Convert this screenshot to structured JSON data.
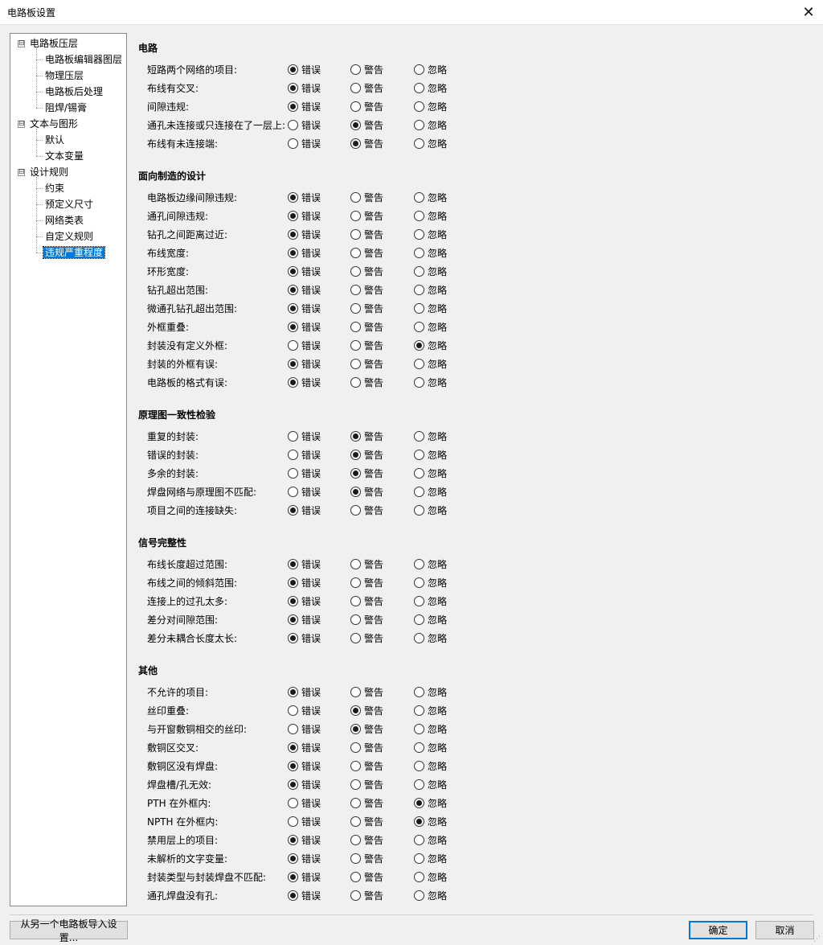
{
  "window": {
    "title": "电路板设置",
    "close_label": "✕"
  },
  "tree": [
    {
      "label": "电路板压层",
      "level": 0,
      "expander": "⊟"
    },
    {
      "label": "电路板编辑器图层",
      "level": 1
    },
    {
      "label": "物理压层",
      "level": 1
    },
    {
      "label": "电路板后处理",
      "level": 1
    },
    {
      "label": "阻焊/锡膏",
      "level": 1
    },
    {
      "label": "文本与图形",
      "level": 0,
      "expander": "⊟"
    },
    {
      "label": "默认",
      "level": 1
    },
    {
      "label": "文本变量",
      "level": 1
    },
    {
      "label": "设计规则",
      "level": 0,
      "expander": "⊟"
    },
    {
      "label": "约束",
      "level": 1
    },
    {
      "label": "预定义尺寸",
      "level": 1
    },
    {
      "label": "网络类表",
      "level": 1
    },
    {
      "label": "自定义规则",
      "level": 1
    },
    {
      "label": "违规严重程度",
      "level": 1,
      "selected": true
    }
  ],
  "options": {
    "error": "错误",
    "warning": "警告",
    "ignore": "忽略"
  },
  "sections": [
    {
      "title": "电路",
      "rows": [
        {
          "label": "短路两个网络的项目:",
          "value": "error"
        },
        {
          "label": "布线有交叉:",
          "value": "error"
        },
        {
          "label": "间隙违规:",
          "value": "error"
        },
        {
          "label": "通孔未连接或只连接在了一层上:",
          "value": "warning"
        },
        {
          "label": "布线有未连接端:",
          "value": "warning"
        }
      ]
    },
    {
      "title": "面向制造的设计",
      "rows": [
        {
          "label": "电路板边缘间隙违规:",
          "value": "error"
        },
        {
          "label": "通孔间隙违规:",
          "value": "error"
        },
        {
          "label": "钻孔之间距离过近:",
          "value": "error"
        },
        {
          "label": "布线宽度:",
          "value": "error"
        },
        {
          "label": "环形宽度:",
          "value": "error"
        },
        {
          "label": "钻孔超出范围:",
          "value": "error"
        },
        {
          "label": "微通孔钻孔超出范围:",
          "value": "error"
        },
        {
          "label": "外框重叠:",
          "value": "error"
        },
        {
          "label": "封装没有定义外框:",
          "value": "ignore"
        },
        {
          "label": "封装的外框有误:",
          "value": "error"
        },
        {
          "label": "电路板的格式有误:",
          "value": "error"
        }
      ]
    },
    {
      "title": "原理图一致性检验",
      "rows": [
        {
          "label": "重复的封装:",
          "value": "warning"
        },
        {
          "label": "错误的封装:",
          "value": "warning"
        },
        {
          "label": "多余的封装:",
          "value": "warning"
        },
        {
          "label": "焊盘网络与原理图不匹配:",
          "value": "warning"
        },
        {
          "label": "项目之间的连接缺失:",
          "value": "error"
        }
      ]
    },
    {
      "title": "信号完整性",
      "rows": [
        {
          "label": "布线长度超过范围:",
          "value": "error"
        },
        {
          "label": "布线之间的倾斜范围:",
          "value": "error"
        },
        {
          "label": "连接上的过孔太多:",
          "value": "error"
        },
        {
          "label": "差分对间隙范围:",
          "value": "error"
        },
        {
          "label": "差分未耦合长度太长:",
          "value": "error"
        }
      ]
    },
    {
      "title": "其他",
      "rows": [
        {
          "label": "不允许的项目:",
          "value": "error"
        },
        {
          "label": "丝印重叠:",
          "value": "warning"
        },
        {
          "label": "与开窗敷铜相交的丝印:",
          "value": "warning"
        },
        {
          "label": "敷铜区交叉:",
          "value": "error"
        },
        {
          "label": "敷铜区没有焊盘:",
          "value": "error"
        },
        {
          "label": "焊盘槽/孔无效:",
          "value": "error"
        },
        {
          "label": "PTH 在外框内:",
          "value": "ignore"
        },
        {
          "label": "NPTH 在外框内:",
          "value": "ignore"
        },
        {
          "label": "禁用层上的项目:",
          "value": "error"
        },
        {
          "label": "未解析的文字变量:",
          "value": "error"
        },
        {
          "label": "封装类型与封装焊盘不匹配:",
          "value": "error"
        },
        {
          "label": "通孔焊盘没有孔:",
          "value": "error"
        }
      ]
    }
  ],
  "footer": {
    "import_label": "从另一个电路板导入设置...",
    "ok_label": "确定",
    "cancel_label": "取消"
  }
}
